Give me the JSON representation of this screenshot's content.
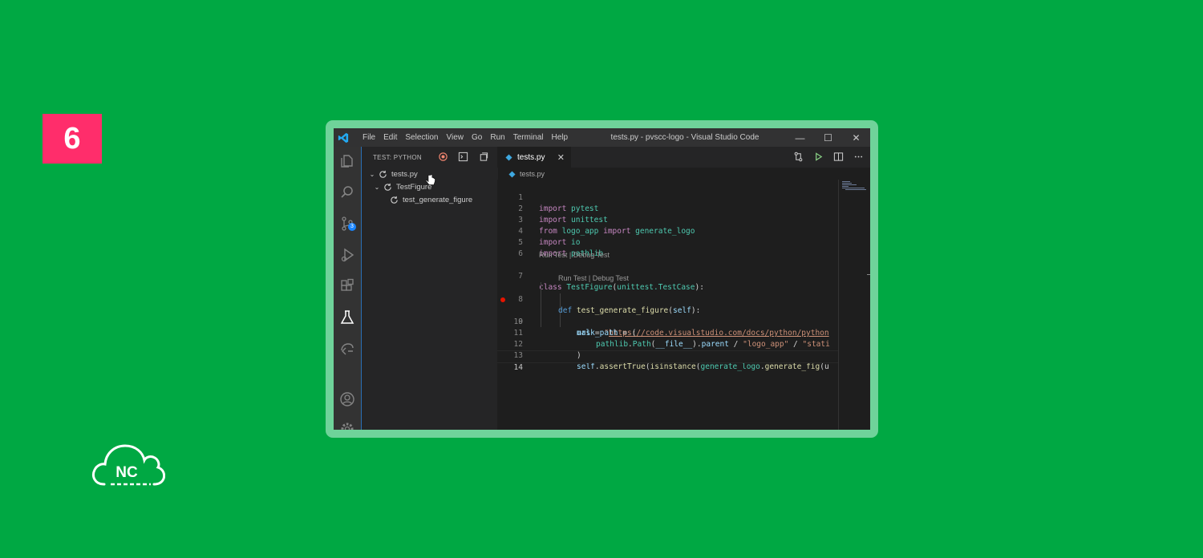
{
  "badge": {
    "number": "6",
    "color": "#ff2d6b"
  },
  "brand": {
    "text": "NC"
  },
  "window": {
    "title": "tests.py - pvscc-logo - Visual Studio Code",
    "menu": [
      "File",
      "Edit",
      "Selection",
      "View",
      "Go",
      "Run",
      "Terminal",
      "Help"
    ],
    "controls": {
      "minimize": "—",
      "maximize": "☐",
      "close": "✕"
    }
  },
  "activity_bar": {
    "items": [
      "explorer-icon",
      "search-icon",
      "source-control-icon",
      "run-debug-icon",
      "extensions-icon",
      "testing-icon",
      "remote-icon",
      "account-icon",
      "settings-icon"
    ],
    "scm_badge": "3"
  },
  "sidebar": {
    "header": "TEST: PYTHON",
    "tree": [
      {
        "label": "tests.py",
        "chevron": "⌄"
      },
      {
        "label": "TestFigure",
        "chevron": "⌄"
      },
      {
        "label": "test_generate_figure",
        "chevron": ""
      }
    ]
  },
  "editor": {
    "tab": {
      "label": "tests.py",
      "close": "✕"
    },
    "breadcrumb": "tests.py",
    "codelens": [
      "Run Test | Debug Test",
      "Run Test | Debug Test"
    ],
    "line_numbers": [
      "1",
      "2",
      "3",
      "4",
      "5",
      "6",
      "7",
      "8",
      "9",
      "10",
      "11",
      "12",
      "13",
      "14"
    ],
    "lines": {
      "l1": {
        "kw": "import",
        "mod": " pytest"
      },
      "l2": {
        "kw": "import",
        "mod": " unittest"
      },
      "l3": {
        "kw1": "from",
        "mod": " logo_app ",
        "kw2": "import",
        "fn": " generate_logo"
      },
      "l4": {
        "kw": "import",
        "mod": " io"
      },
      "l5": {
        "kw": "import",
        "mod": " pathlib"
      },
      "l7": {
        "kw": "class",
        "cls": " TestFigure",
        "p1": "(",
        "base": "unittest.TestCase",
        "p2": "):"
      },
      "l8": {
        "kw": "def",
        "fn": " test_generate_figure",
        "p1": "(",
        "self": "self",
        "p2": "):"
      },
      "l9": {
        "var": "url",
        "p1": " = ",
        "q": "\"",
        "link": "https://code.visualstudio.com/docs/python/python"
      },
      "l10": {
        "var": "mask_path",
        "p1": " = ("
      },
      "l11": {
        "mod": "pathlib",
        "p1": ".",
        "fn": "Path",
        "p2": "(",
        "var": "__file__",
        "p3": ").",
        "attr": "parent",
        "p4": " / ",
        "s1": "\"logo_app\"",
        "p5": " / ",
        "s2": "\"stati"
      },
      "l12": {
        "p1": ")"
      },
      "l13": {
        "self": "self",
        "p1": ".",
        "fn": "assertTrue",
        "p2": "(",
        "fn2": "isinstance",
        "p3": "(",
        "mod": "generate_logo",
        "p4": ".",
        "fn3": "generate_fig",
        "p5": "(u"
      }
    }
  },
  "colors": {
    "background": "#00a843",
    "frame": "#6fd39a",
    "accent": "#1a85ff"
  }
}
